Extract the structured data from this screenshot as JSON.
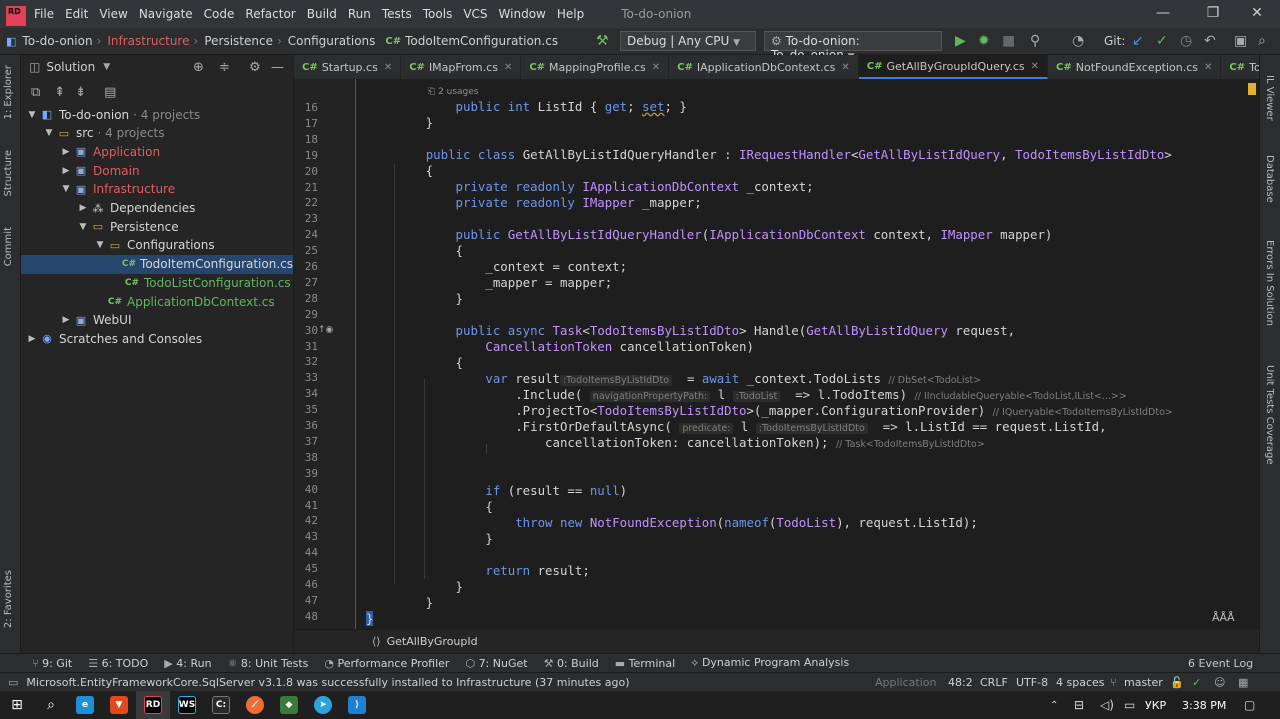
{
  "menubar": {
    "items": [
      "File",
      "Edit",
      "View",
      "Navigate",
      "Code",
      "Refactor",
      "Build",
      "Run",
      "Tests",
      "Tools",
      "VCS",
      "Window",
      "Help"
    ],
    "title": "To-do-onion",
    "logo": "RD"
  },
  "navbar": {
    "breadcrumbs": [
      "To-do-onion",
      "Infrastructure",
      "Persistence",
      "Configurations",
      "TodoItemConfiguration.cs"
    ],
    "config": "Debug | Any CPU",
    "run_target": "To-do-onion: To_do_onion",
    "git_label": "Git:"
  },
  "explorer": {
    "header": "Solution",
    "tree": [
      {
        "label": "To-do-onion",
        "suffix": "· 4 projects",
        "depth": 0,
        "tw": "▼",
        "icon": "solution-icon",
        "color": "c-wht"
      },
      {
        "label": "src",
        "suffix": "· 4 projects",
        "depth": 1,
        "tw": "▼",
        "icon": "folder-icon",
        "color": "c-wht"
      },
      {
        "label": "Application",
        "suffix": "",
        "depth": 2,
        "tw": "▶",
        "icon": "project-icon",
        "color": "c-red"
      },
      {
        "label": "Domain",
        "suffix": "",
        "depth": 2,
        "tw": "▶",
        "icon": "project-icon",
        "color": "c-red"
      },
      {
        "label": "Infrastructure",
        "suffix": "",
        "depth": 2,
        "tw": "▼",
        "icon": "project-icon",
        "color": "c-red"
      },
      {
        "label": "Dependencies",
        "suffix": "",
        "depth": 3,
        "tw": "▶",
        "icon": "dependencies-icon",
        "color": "c-wht"
      },
      {
        "label": "Persistence",
        "suffix": "",
        "depth": 3,
        "tw": "▼",
        "icon": "folder-icon",
        "color": "c-wht"
      },
      {
        "label": "Configurations",
        "suffix": "",
        "depth": 4,
        "tw": "▼",
        "icon": "folder-icon",
        "color": "c-wht"
      },
      {
        "label": "TodoItemConfiguration.cs",
        "suffix": "",
        "depth": 5,
        "tw": "",
        "icon": "csharp-file-icon",
        "color": "c-wht",
        "selected": true
      },
      {
        "label": "TodoListConfiguration.cs",
        "suffix": "",
        "depth": 5,
        "tw": "",
        "icon": "csharp-file-icon",
        "color": "c-grn"
      },
      {
        "label": "ApplicationDbContext.cs",
        "suffix": "",
        "depth": 4,
        "tw": "",
        "icon": "csharp-file-icon",
        "color": "c-grn"
      },
      {
        "label": "WebUI",
        "suffix": "",
        "depth": 2,
        "tw": "▶",
        "icon": "project-icon",
        "color": "c-wht"
      },
      {
        "label": "Scratches and Consoles",
        "suffix": "",
        "depth": 0,
        "tw": "▶",
        "icon": "scratches-icon",
        "color": "c-wht"
      }
    ]
  },
  "left_strip": [
    "1: Explorer",
    "Structure",
    "Commit",
    "2: Favorites"
  ],
  "right_strip": [
    "IL Viewer",
    "Database",
    "Errors In Solution",
    "Unit Tests Coverage"
  ],
  "tabs": [
    {
      "label": "Startup.cs"
    },
    {
      "label": "IMapFrom.cs"
    },
    {
      "label": "MappingProfile.cs"
    },
    {
      "label": "IApplicationDbContext.cs"
    },
    {
      "label": "GetAllByGroupIdQuery.cs",
      "active": true
    },
    {
      "label": "NotFoundException.cs"
    },
    {
      "label": "TodoItemDto"
    }
  ],
  "editor": {
    "usages_hint": "2 usages",
    "line_numbers": [
      "16",
      "17",
      "18",
      "19",
      "20",
      "21",
      "22",
      "23",
      "24",
      "25",
      "26",
      "27",
      "28",
      "29",
      "30",
      "31",
      "32",
      "33",
      "34",
      "35",
      "36",
      "37",
      "38",
      "39",
      "40",
      "41",
      "42",
      "43",
      "44",
      "45",
      "46",
      "47",
      "48"
    ],
    "hints": {
      "h33a": ":TodoItemsByListIdDto",
      "h33b": "// DbSet<TodoList>",
      "h34a": "navigationPropertyPath:",
      "h34b": ":TodoList",
      "h34c": "// IIncludableQueryable<TodoList,IList<...>>",
      "h35": "// IQueryable<TodoItemsByListIdDto>",
      "h36a": "predicate:",
      "h36b": ":TodoItemsByListIdDto",
      "h37": "// Task<TodoItemsByListIdDto>"
    },
    "breadcrumb": "GetAllByGroupId"
  },
  "toolwindows": [
    "9: Git",
    "6: TODO",
    "4: Run",
    "8: Unit Tests",
    "Performance Profiler",
    "7: NuGet",
    "0: Build",
    "Terminal",
    "Dynamic Program Analysis"
  ],
  "event_log": "6 Event Log",
  "status": {
    "message": "Microsoft.EntityFrameworkCore.SqlServer v3.1.8 was successfully installed to Infrastructure (37 minutes ago)",
    "project": "Application",
    "position": "48:2",
    "line_ending": "CRLF",
    "encoding": "UTF-8",
    "indent": "4 spaces",
    "branch": "master"
  },
  "taskbar": {
    "lang": "УКР",
    "time": "3:38 PM"
  }
}
